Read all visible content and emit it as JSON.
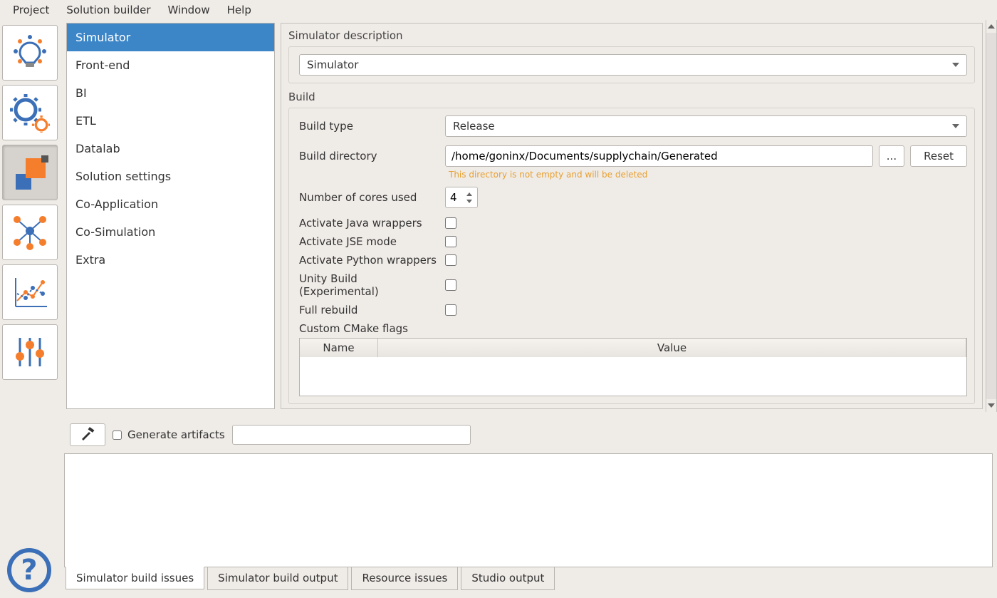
{
  "menubar": [
    "Project",
    "Solution builder",
    "Window",
    "Help"
  ],
  "sidebar": {
    "items": [
      "Simulator",
      "Front-end",
      "BI",
      "ETL",
      "Datalab",
      "Solution settings",
      "Co-Application",
      "Co-Simulation",
      "Extra"
    ],
    "selected_index": 0
  },
  "form": {
    "description_title": "Simulator description",
    "description_value": "Simulator",
    "build_title": "Build",
    "build_type_label": "Build type",
    "build_type_value": "Release",
    "build_dir_label": "Build directory",
    "build_dir_value": "/home/goninx/Documents/supplychain/Generated",
    "browse_label": "...",
    "reset_label": "Reset",
    "dir_warning": "This directory is not empty and will be deleted",
    "cores_label": "Number of cores used",
    "cores_value": "4",
    "checks": [
      {
        "label": "Activate Java wrappers",
        "checked": false
      },
      {
        "label": "Activate JSE mode",
        "checked": false
      },
      {
        "label": "Activate Python wrappers",
        "checked": false
      },
      {
        "label": "Unity Build (Experimental)",
        "checked": false
      },
      {
        "label": "Full rebuild",
        "checked": false
      }
    ],
    "cmake_label": "Custom CMake flags",
    "cmake_cols": {
      "name": "Name",
      "value": "Value"
    }
  },
  "bottom": {
    "generate_label": "Generate artifacts",
    "generate_checked": false,
    "generate_input_value": ""
  },
  "tabs": [
    "Simulator build issues",
    "Simulator build output",
    "Resource issues",
    "Studio output"
  ],
  "tabs_active_index": 0
}
